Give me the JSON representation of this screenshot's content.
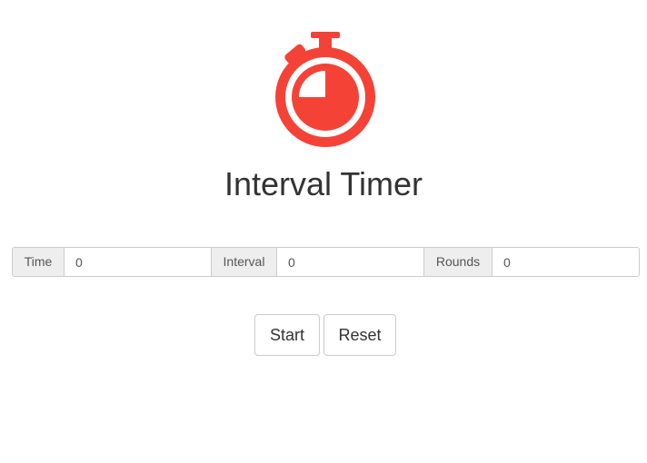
{
  "app": {
    "title": "Interval Timer",
    "accent_color": "#f44336",
    "logo_icon": "stopwatch-icon"
  },
  "fields": [
    {
      "label": "Time",
      "value": "0"
    },
    {
      "label": "Interval",
      "value": "0"
    },
    {
      "label": "Rounds",
      "value": "0"
    }
  ],
  "buttons": {
    "start_label": "Start",
    "reset_label": "Reset"
  }
}
